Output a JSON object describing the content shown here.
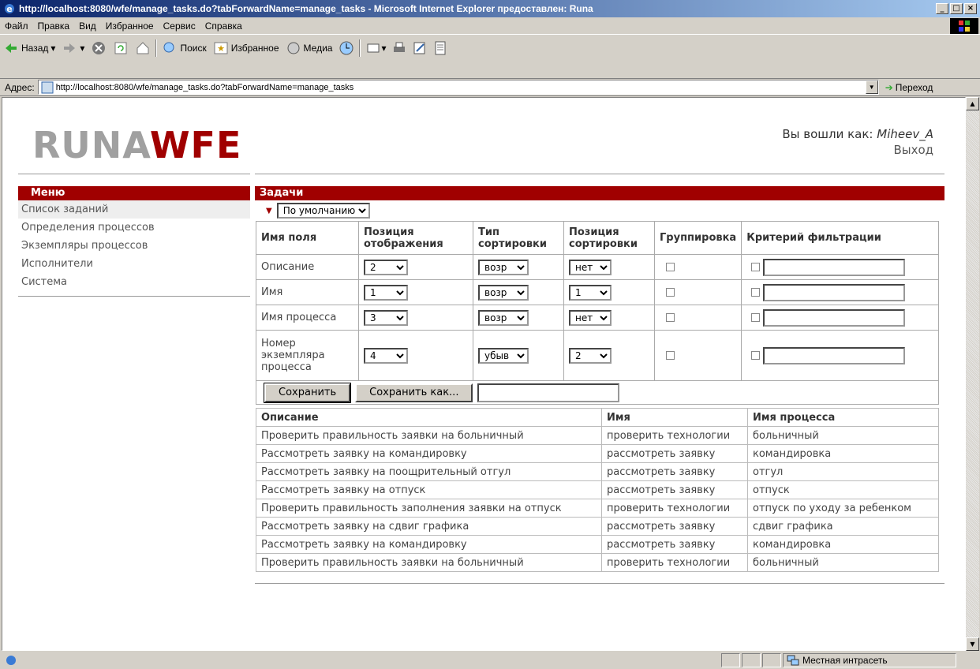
{
  "window": {
    "title": "http://localhost:8080/wfe/manage_tasks.do?tabForwardName=manage_tasks - Microsoft Internet Explorer предоставлен: Runa"
  },
  "menubar": [
    "Файл",
    "Правка",
    "Вид",
    "Избранное",
    "Сервис",
    "Справка"
  ],
  "toolbar": {
    "back": "Назад",
    "search": "Поиск",
    "favorites": "Избранное",
    "media": "Медиа"
  },
  "address": {
    "label": "Адрес:",
    "url": "http://localhost:8080/wfe/manage_tasks.do?tabForwardName=manage_tasks",
    "go": "Переход"
  },
  "status": {
    "zone": "Местная интрасеть"
  },
  "logo": {
    "left": "RUNA",
    "right": "WFE"
  },
  "user": {
    "prefix": "Вы вошли как:",
    "name": "Miheev_A",
    "logout": "Выход"
  },
  "menu": {
    "title": "Меню",
    "items": [
      "Список заданий",
      "Определения процессов",
      "Экземпляры процессов",
      "Исполнители",
      "Система"
    ]
  },
  "tasks": {
    "title": "Задачи",
    "preset": "По умолчанию",
    "config_headers": [
      "Имя поля",
      "Позиция отображения",
      "Тип сортировки",
      "Позиция сортировки",
      "Группировка",
      "Критерий фильтрации"
    ],
    "config_rows": [
      {
        "field": "Описание",
        "display_pos": "2",
        "sort_type": "возр",
        "sort_pos": "нет"
      },
      {
        "field": "Имя",
        "display_pos": "1",
        "sort_type": "возр",
        "sort_pos": "1"
      },
      {
        "field": "Имя процесса",
        "display_pos": "3",
        "sort_type": "возр",
        "sort_pos": "нет"
      },
      {
        "field": "Номер экземпляра процесса",
        "display_pos": "4",
        "sort_type": "убыв",
        "sort_pos": "2"
      }
    ],
    "save": "Сохранить",
    "save_as": "Сохранить как...",
    "list_headers": [
      "Описание",
      "Имя",
      "Имя процесса"
    ],
    "list_rows": [
      [
        "Проверить правильность заявки на больничный",
        "проверить технологии",
        "больничный"
      ],
      [
        "Рассмотреть заявку на командировку",
        "рассмотреть заявку",
        "командировка"
      ],
      [
        "Рассмотреть заявку на поощрительный отгул",
        "рассмотреть заявку",
        "отгул"
      ],
      [
        "Рассмотреть заявку на отпуск",
        "рассмотреть заявку",
        "отпуск"
      ],
      [
        "Проверить правильность заполнения заявки на отпуск",
        "проверить технологии",
        "отпуск по уходу за ребенком"
      ],
      [
        "Рассмотреть заявку на сдвиг графика",
        "рассмотреть заявку",
        "сдвиг графика"
      ],
      [
        "Рассмотреть заявку на командировку",
        "рассмотреть заявку",
        "командировка"
      ],
      [
        "Проверить правильность заявки на больничный",
        "проверить технологии",
        "больничный"
      ]
    ]
  }
}
